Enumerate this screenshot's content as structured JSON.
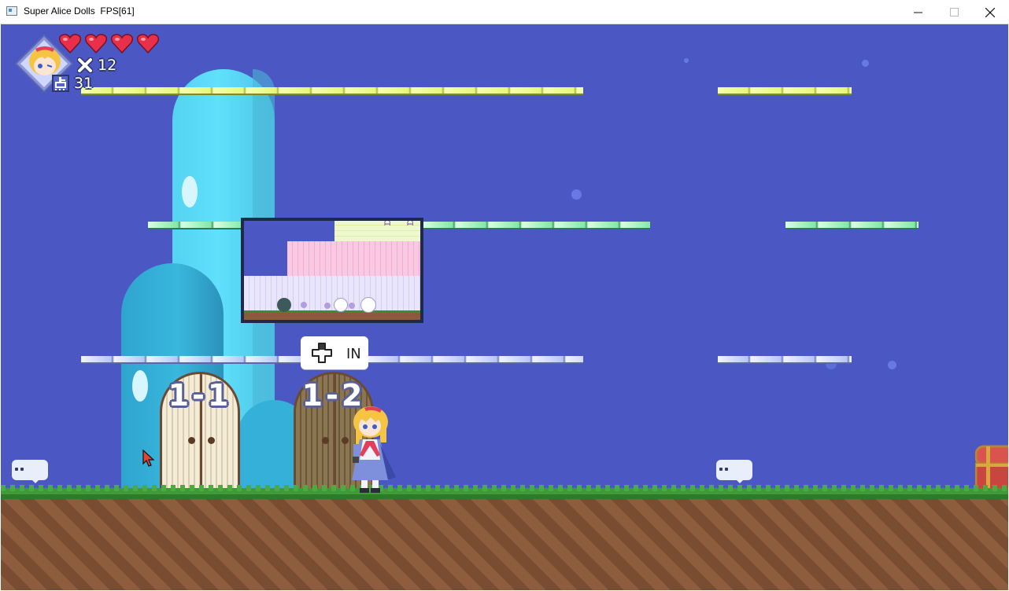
{
  "window": {
    "title": "Super Alice Dolls  FPS[61]",
    "controls": [
      "minimize",
      "maximize",
      "close"
    ]
  },
  "hud": {
    "hearts": 4,
    "lives_icon": "x-mark-icon",
    "lives": "12",
    "points_icon": "point-tile-icon",
    "points": "31"
  },
  "scene": {
    "background_color": "#4b58c4",
    "doors": [
      {
        "label": "1-1",
        "style": "light-wood"
      },
      {
        "label": "1-2",
        "style": "dark-wood"
      }
    ],
    "tooltip": {
      "icon": "dpad-icon",
      "label": "IN"
    },
    "preview_icon_chars": [
      "ᗩ",
      "ᗩ"
    ]
  }
}
